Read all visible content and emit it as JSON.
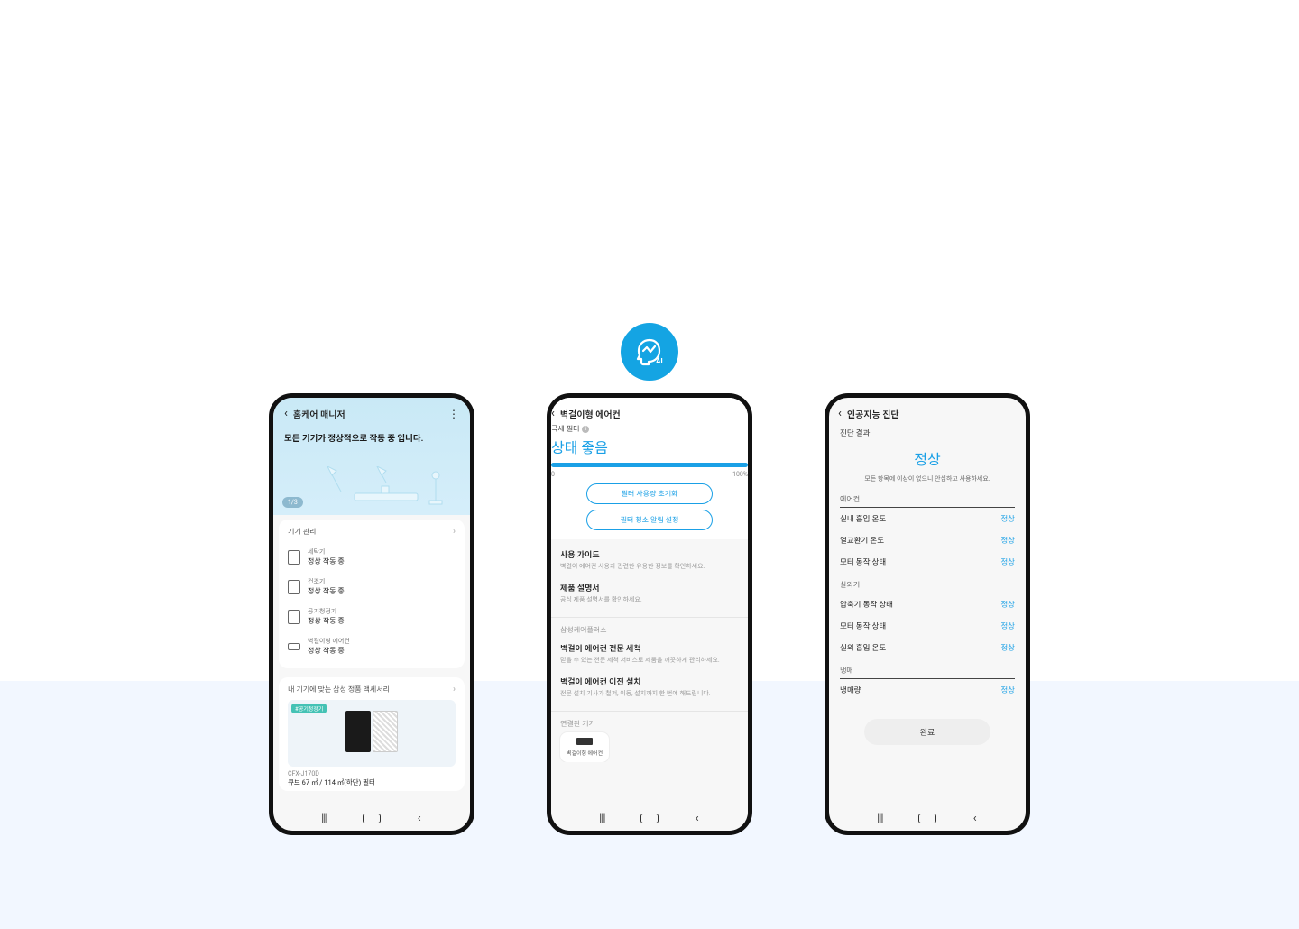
{
  "ai_badge": {
    "label": "AI"
  },
  "phone1": {
    "header": {
      "title": "홈케어 매니저"
    },
    "hero": {
      "message": "모든 기기가 정상적으로 작동 중 입니다.",
      "pager": "1/3"
    },
    "device_section": {
      "title": "기기 관리",
      "items": [
        {
          "name": "세탁기",
          "status": "정상 작동 중"
        },
        {
          "name": "건조기",
          "status": "정상 작동 중"
        },
        {
          "name": "공기청정기",
          "status": "정상 작동 중"
        },
        {
          "name": "벽걸이형 에어컨",
          "status": "정상 작동 중"
        }
      ]
    },
    "accessory": {
      "title": "내 기기에 맞는 삼성 정품 액세서리",
      "tag": "#공기청정기",
      "model": "CFX-J170D",
      "desc": "큐브 67 ㎡ / 114 ㎡(하단) 필터"
    }
  },
  "phone2": {
    "header": {
      "title": "벽걸이형 에어컨"
    },
    "filter": {
      "label": "극세 필터",
      "status": "상태 좋음",
      "scale_min": "0",
      "scale_max": "100%",
      "btn_reset": "필터 사용량 초기화",
      "btn_alarm": "필터 청소 알림 설정"
    },
    "links": [
      {
        "title": "사용 가이드",
        "sub": "벽걸이 에어컨 사용과 관련한 유용한 정보를 확인하세요."
      },
      {
        "title": "제품 설명서",
        "sub": "공식 제품 설명서를 확인하세요."
      }
    ],
    "careplus": {
      "group": "삼성케어플러스",
      "items": [
        {
          "title": "벽걸이 에어컨 전문 세척",
          "sub": "믿을 수 있는 전문 세척 서비스로 제품을 깨끗하게 관리하세요."
        },
        {
          "title": "벽걸이 에어컨 이전 설치",
          "sub": "전문 설치 기사가 철거, 이동, 설치까지 한 번에 해드립니다."
        }
      ]
    },
    "connected": {
      "group": "연결된 기기",
      "device": "벽걸이형 에어컨"
    }
  },
  "phone3": {
    "header": {
      "title": "인공지능 진단"
    },
    "subtitle": "진단 결과",
    "verdict": "정상",
    "verdict_sub": "모든 항목에 이상이 없으니 안심하고 사용하세요.",
    "groups": [
      {
        "name": "에어컨",
        "rows": [
          {
            "label": "실내 흡입 온도",
            "value": "정상"
          },
          {
            "label": "열교환기 온도",
            "value": "정상"
          },
          {
            "label": "모터 동작 상태",
            "value": "정상"
          }
        ]
      },
      {
        "name": "실외기",
        "rows": [
          {
            "label": "압축기 동작 상태",
            "value": "정상"
          },
          {
            "label": "모터 동작 상태",
            "value": "정상"
          },
          {
            "label": "실외 흡입 온도",
            "value": "정상"
          }
        ]
      },
      {
        "name": "냉매",
        "rows": [
          {
            "label": "냉매량",
            "value": "정상"
          }
        ]
      }
    ],
    "done": "완료"
  }
}
